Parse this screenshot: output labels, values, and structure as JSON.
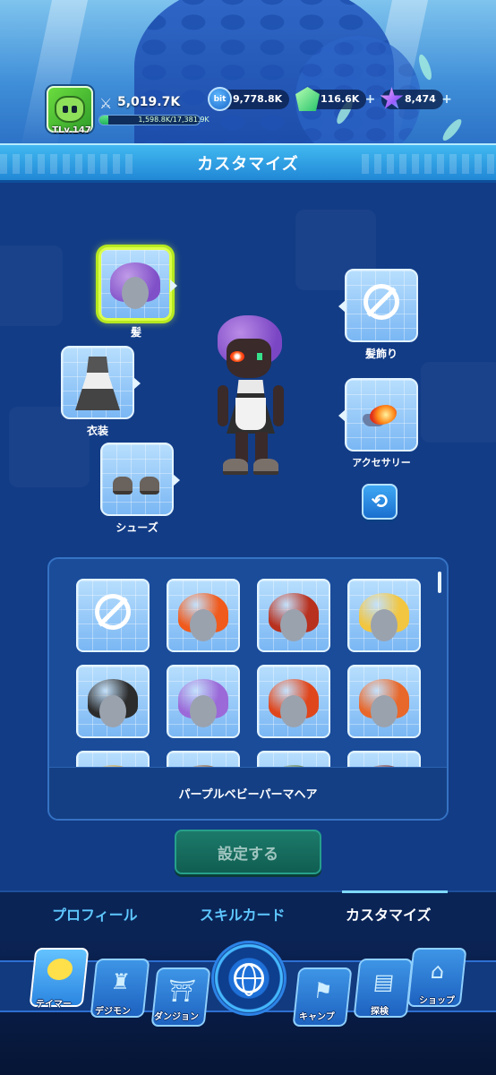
{
  "status": {
    "tamer_level": "TLv.147",
    "power": "5,019.7K",
    "exp_text": "1,598.8K/17,381.9K",
    "exp_progress": 0.092,
    "bit_label": "bit",
    "bits": "9,778.8K",
    "gems": "116.6K",
    "stars": "8,474",
    "plus": "+"
  },
  "header": {
    "title": "カスタマイズ"
  },
  "slots": {
    "hair": "髪",
    "costume": "衣装",
    "shoes": "シューズ",
    "hair_accessory": "髪飾り",
    "accessory": "アクセサリー"
  },
  "colors": {
    "accent": "#dcff4a",
    "header": "#2a9ae0",
    "panel": "#123c86"
  },
  "grid": {
    "items": [
      {
        "kind": "none"
      },
      {
        "kind": "hair",
        "color": "#f05a1c"
      },
      {
        "kind": "hair",
        "color": "#b8301e"
      },
      {
        "kind": "hair",
        "color": "#f2c640"
      },
      {
        "kind": "hair",
        "color": "#2c2c2c"
      },
      {
        "kind": "hair",
        "color": "#9b6ad8"
      },
      {
        "kind": "hair",
        "color": "#e0461c"
      },
      {
        "kind": "hair",
        "color": "#e8672a"
      },
      {
        "kind": "hair",
        "color": "#c8a040"
      },
      {
        "kind": "hair",
        "color": "#8a5a30"
      },
      {
        "kind": "hair",
        "color": "#5a7a3a"
      },
      {
        "kind": "hair",
        "color": "#7a3030"
      }
    ],
    "selected_name": "パープルベビーパーマヘア"
  },
  "set_button": "設定する",
  "tabs": [
    "プロフィール",
    "スキルカード",
    "カスタマイズ"
  ],
  "nav": {
    "tamer": "テイマー",
    "digimon": "デジモン",
    "dungeon": "ダンジョン",
    "camp": "キャンプ",
    "explore": "探検",
    "shop": "ショップ"
  }
}
